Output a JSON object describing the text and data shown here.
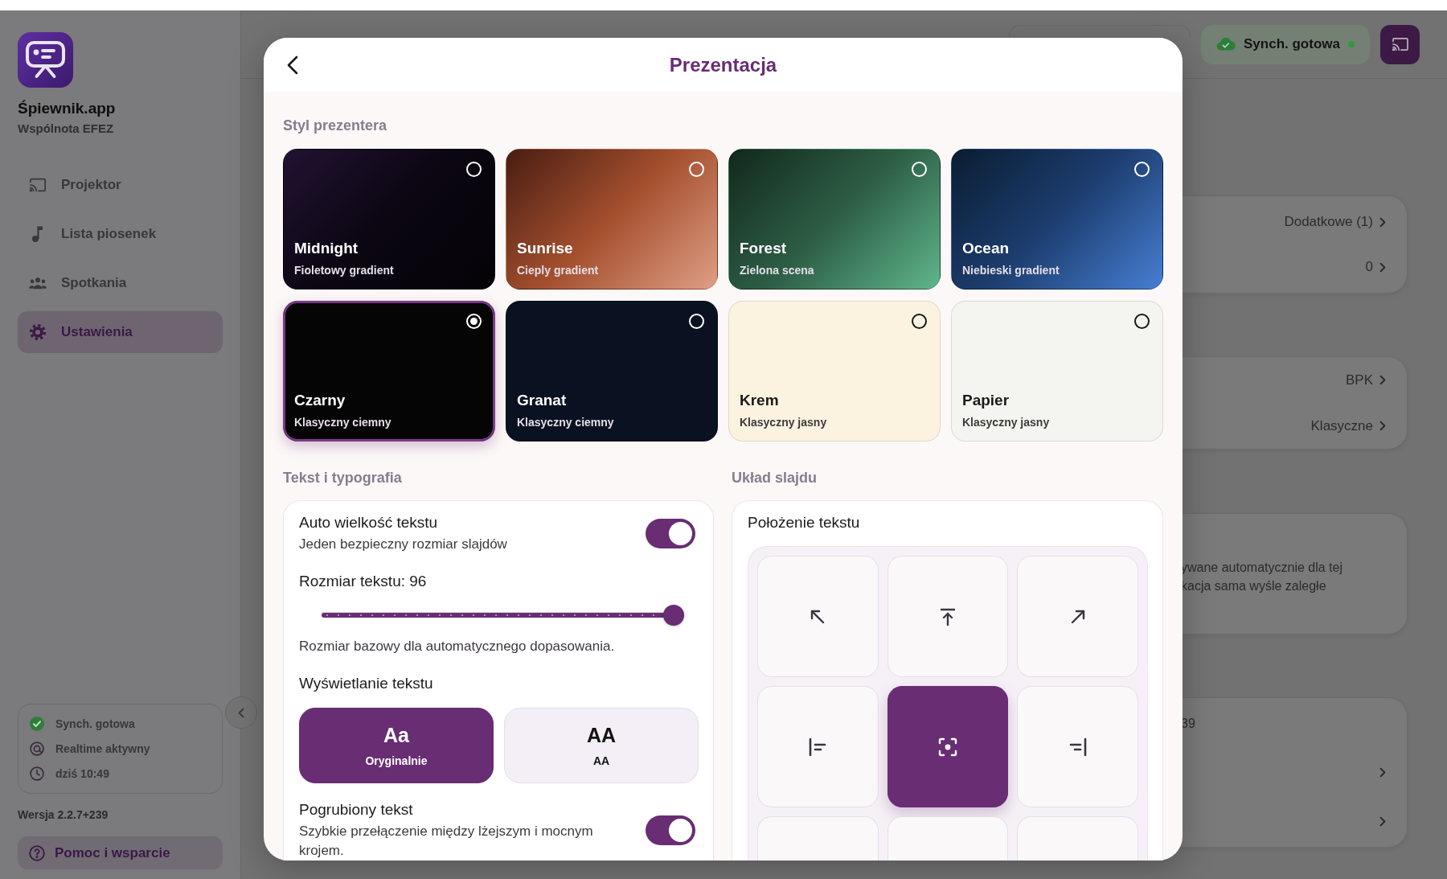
{
  "sidebar": {
    "app_name": "Śpiewnik.app",
    "organization": "Wspólnota EFEZ",
    "nav_items": [
      {
        "label": "Projektor",
        "kind": "cast",
        "selected": false
      },
      {
        "label": "Lista piosenek",
        "kind": "note",
        "selected": false
      },
      {
        "label": "Spotkania",
        "kind": "people",
        "selected": false
      },
      {
        "label": "Ustawienia",
        "kind": "gear",
        "selected": true
      }
    ],
    "status": [
      {
        "kind": "sync",
        "text": "Synch. gotowa"
      },
      {
        "kind": "realtime",
        "text": "Realtime aktywny"
      },
      {
        "kind": "time",
        "text": "dziś 10:49"
      }
    ],
    "version": "Wersja 2.2.7+239",
    "help_button": "Pomoc i wsparcie"
  },
  "top_bar": {
    "sync_badge": "Synch. gotowa"
  },
  "background_cards": [
    {
      "rows": [
        {
          "kind": "link",
          "value": "Dodatkowe (1)"
        },
        {
          "kind": "link",
          "value": "0"
        }
      ]
    },
    {
      "rows": [
        {
          "kind": "link",
          "value": "BPK"
        },
        {
          "kind": "link",
          "value": "Klasyczne"
        }
      ]
    },
    {
      "lines": [
        "ywane automatycznie dla tej",
        "kacja sama wyśle zaległe"
      ]
    },
    {
      "lines": [
        "39"
      ],
      "rows": [
        {
          "kind": "link"
        },
        {
          "kind": "link"
        }
      ]
    }
  ],
  "modal": {
    "title": "Prezentacja",
    "presenter_style": {
      "heading": "Styl prezentera",
      "items": [
        {
          "name": "Midnight",
          "description": "Fioletowy gradient",
          "kind": "fading",
          "color": "#0b0611",
          "selected": false
        },
        {
          "name": "Sunrise",
          "description": "Cieply gradient",
          "kind": "rising",
          "color": "#a5502f",
          "selected": false
        },
        {
          "name": "Forest",
          "description": "Zielona scena",
          "kind": "rising",
          "color": "#2d5e46",
          "selected": false
        },
        {
          "name": "Ocean",
          "description": "Niebieski gradient",
          "kind": "rising",
          "color": "#1d3e70",
          "selected": false
        },
        {
          "name": "Czarny",
          "description": "Klasyczny ciemny",
          "kind": "solid",
          "color": "#050505",
          "selected": true
        },
        {
          "name": "Granat",
          "description": "Klasyczny ciemny",
          "kind": "solid",
          "color": "#0a1120",
          "selected": false
        },
        {
          "name": "Krem",
          "description": "Klasyczny jasny",
          "kind": "solid",
          "color": "#fcf2e0",
          "selected": false
        },
        {
          "name": "Papier",
          "description": "Klasyczny jasny",
          "kind": "solid",
          "color": "#f4f5f0",
          "selected": false
        }
      ]
    },
    "typography": {
      "heading": "Tekst i typografia",
      "auto_size": {
        "label": "Auto wielkość tekstu",
        "description": "Jeden bezpieczny rozmiar slajdów",
        "on": true
      },
      "text_size": {
        "label": "Rozmiar tekstu: 96",
        "level": 1
      },
      "text_size_hint": "Rozmiar bazowy dla automatycznego dopasowania.",
      "display": {
        "label": "Wyświetlanie tekstu",
        "options": [
          {
            "sample": "Aa",
            "label": "Oryginalnie",
            "selected": true
          },
          {
            "sample": "AA",
            "label": "AA",
            "selected": false
          }
        ]
      },
      "bold_text": {
        "label": "Pogrubiony tekst",
        "description": "Szybkie przełączenie między lżejszym i mocnym krojem.",
        "on": true
      }
    },
    "layout": {
      "heading": "Układ slajdu",
      "position": {
        "label": "Położenie tekstu",
        "cells": [
          {
            "kind": "northwest",
            "selected": false
          },
          {
            "kind": "north",
            "selected": false
          },
          {
            "kind": "northeast",
            "selected": false
          },
          {
            "kind": "west",
            "selected": false
          },
          {
            "kind": "center",
            "selected": true
          },
          {
            "kind": "east",
            "selected": false
          },
          {
            "selected": false
          },
          {
            "selected": false
          },
          {
            "selected": false
          }
        ]
      }
    }
  }
}
